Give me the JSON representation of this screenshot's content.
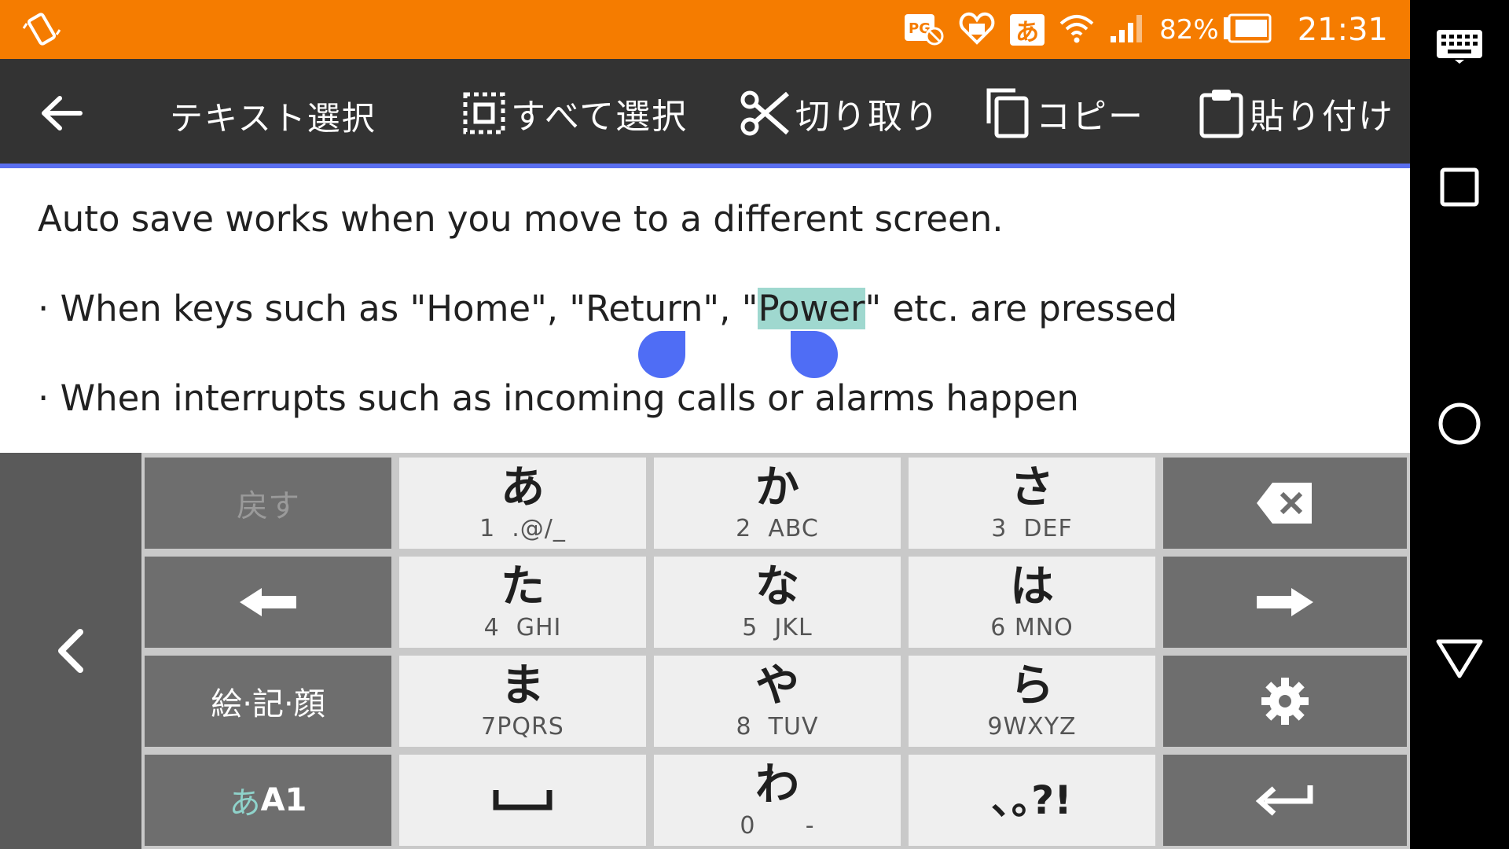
{
  "status_bar": {
    "left_icon": "screen-rotate-icon",
    "icons": [
      "notification-app-icon",
      "heart-mail-icon",
      "ime-hiragana-icon",
      "wifi-icon",
      "signal-icon"
    ],
    "ime_char": "あ",
    "battery_percent": "82%",
    "time": "21:31"
  },
  "nav_bar": {
    "icons": [
      "keyboard-icon",
      "recents-icon",
      "home-icon",
      "back-icon"
    ]
  },
  "action_bar": {
    "title": "テキスト選択",
    "select_all": "すべて選択",
    "cut": "切り取り",
    "copy": "コピー",
    "paste": "貼り付け",
    "accent_color": "#5a6ff0",
    "bg_color": "#333333"
  },
  "content": {
    "line1": "Auto save works when you move to a different screen.",
    "line2_before": "· When keys such as \"Home\", \"Return\", \"",
    "line2_selected": "Power",
    "line2_after": "\" etc. are pressed",
    "line3": "· When interrupts such as incoming calls or alarms happen",
    "selection_color": "#9fd8cf",
    "handle_color": "#4f6df5"
  },
  "keyboard": {
    "undo": "戻す",
    "symbols": "絵·記·顔",
    "mode_kana": "あ",
    "mode_rest": "A1",
    "punct": "､｡?!",
    "keys": [
      {
        "kana": "あ",
        "sub": "1  .@/_"
      },
      {
        "kana": "か",
        "sub": "2  ABC"
      },
      {
        "kana": "さ",
        "sub": "3  DEF"
      },
      {
        "kana": "た",
        "sub": "4  GHI"
      },
      {
        "kana": "な",
        "sub": "5  JKL"
      },
      {
        "kana": "は",
        "sub": "6 MNO"
      },
      {
        "kana": "ま",
        "sub": "7PQRS"
      },
      {
        "kana": "や",
        "sub": "8  TUV"
      },
      {
        "kana": "ら",
        "sub": "9WXYZ"
      },
      {
        "kana": "わ",
        "sub": "0      -"
      }
    ]
  }
}
